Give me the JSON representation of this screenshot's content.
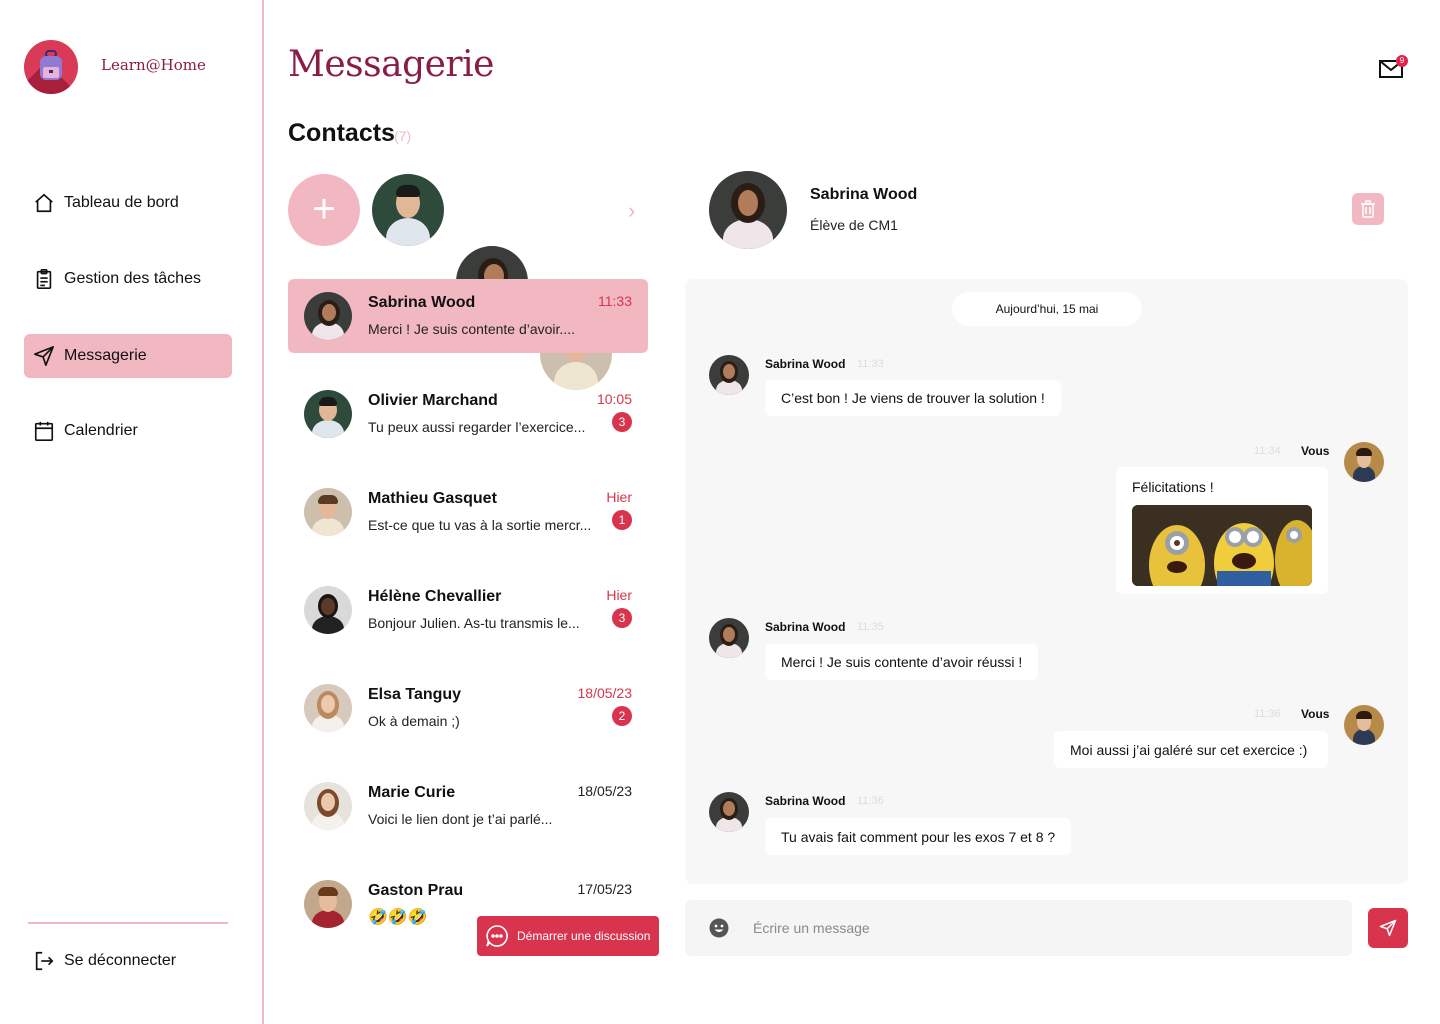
{
  "app": {
    "brand": "Learn@Home",
    "accent": "#d8344e",
    "accent_light": "#f2b8c2",
    "title_color": "#8a1d46"
  },
  "sidebar": {
    "items": [
      {
        "label": "Tableau de bord",
        "icon": "home-icon"
      },
      {
        "label": "Gestion des tâches",
        "icon": "clipboard-icon"
      },
      {
        "label": "Messagerie",
        "icon": "send-icon",
        "active": true
      },
      {
        "label": "Calendrier",
        "icon": "calendar-icon"
      }
    ],
    "logout_label": "Se déconnecter"
  },
  "header": {
    "title": "Messagerie",
    "mail_badge": "9"
  },
  "contacts": {
    "title": "Contacts",
    "count": "(7)",
    "add_label": "+"
  },
  "conversations": [
    {
      "name": "Sabrina Wood",
      "preview": "Merci ! Je suis contente d’avoir....",
      "time": "11:33",
      "badge": "",
      "active": true
    },
    {
      "name": "Olivier Marchand",
      "preview": "Tu peux aussi regarder l’exercice...",
      "time": "10:05",
      "badge": "3"
    },
    {
      "name": "Mathieu Gasquet",
      "preview": "Est-ce que tu vas à la sortie mercr...",
      "time": "Hier",
      "badge": "1"
    },
    {
      "name": "Hélène Chevallier",
      "preview": "Bonjour Julien. As-tu transmis le...",
      "time": "Hier",
      "badge": "3"
    },
    {
      "name": "Elsa Tanguy",
      "preview": "Ok à demain ;)",
      "time": "18/05/23",
      "badge": "2"
    },
    {
      "name": "Marie Curie",
      "preview": "Voici le lien dont je t’ai parlé...",
      "time": "18/05/23",
      "badge": ""
    },
    {
      "name": "Gaston Prau",
      "preview": "🤣🤣🤣",
      "time": "17/05/23",
      "badge": ""
    }
  ],
  "start_discussion_label": "Démarrer une discussion",
  "chat": {
    "name": "Sabrina Wood",
    "role": "Élève de CM1",
    "date_label": "Aujourd’hui, 15 mai",
    "messages": [
      {
        "sender": "Sabrina Wood",
        "time": "11:33",
        "text": "C’est bon ! Je viens de trouver la solution !"
      },
      {
        "sender": "Vous",
        "time": "11:34",
        "text": "Félicitations !",
        "has_image": true
      },
      {
        "sender": "Sabrina Wood",
        "time": "11:35",
        "text": "Merci ! Je suis contente d’avoir réussi !"
      },
      {
        "sender": "Vous",
        "time": "11:36",
        "text": "Moi aussi j’ai galéré sur cet exercice :)"
      },
      {
        "sender": "Sabrina Wood",
        "time": "11:36",
        "text": "Tu avais fait comment pour les exos 7 et 8 ?"
      }
    ],
    "input_placeholder": "Écrire un message"
  }
}
